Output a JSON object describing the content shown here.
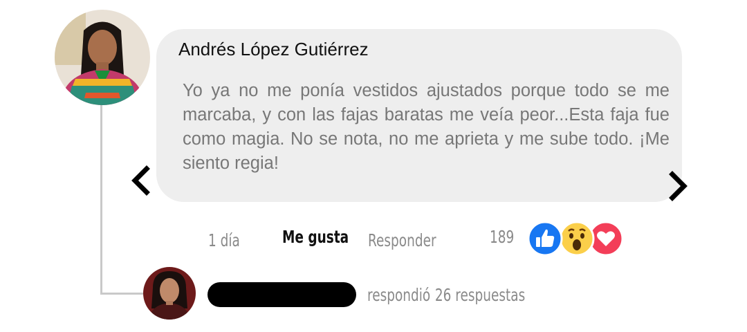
{
  "comment": {
    "author": "Andrés López Gutiérrez",
    "text": "Yo ya no me ponía vestidos ajustados porque todo se me marcaba, y con las fajas baratas me veía peor...Esta faja fue como magia. No se nota, no me aprieta y me sube todo. ¡Me siento regia!",
    "time": "1 día",
    "like_label": "Me gusta",
    "reply_label": "Responder",
    "reaction_count": "189",
    "reactions": [
      "like-icon",
      "wow-icon",
      "love-icon"
    ]
  },
  "reply_summary": {
    "action_text": "respondió",
    "count_text": "26 respuestas"
  },
  "colors": {
    "bubble": "#eeeeee",
    "like_blue": "#1877f2",
    "love_red": "#f33e58",
    "wow_yellow": "#fbcf4a"
  }
}
